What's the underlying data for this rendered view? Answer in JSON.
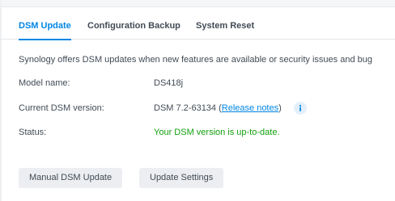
{
  "tabs": [
    {
      "label": "DSM Update",
      "active": true
    },
    {
      "label": "Configuration Backup",
      "active": false
    },
    {
      "label": "System Reset",
      "active": false
    }
  ],
  "description": "Synology offers DSM updates when new features are available or security issues and bug",
  "fields": {
    "model": {
      "label": "Model name:",
      "value": "DS418j"
    },
    "version": {
      "label": "Current DSM version:",
      "value": "DSM 7.2-63134",
      "open_paren": " (",
      "link_text": "Release notes",
      "close_paren": ")"
    },
    "status": {
      "label": "Status:",
      "value": "Your DSM version is up-to-date."
    }
  },
  "buttons": {
    "manual_update": "Manual DSM Update",
    "update_settings": "Update Settings"
  },
  "icons": {
    "info": "info-icon"
  },
  "colors": {
    "accent": "#0086e5",
    "status_ok": "#13a00e",
    "text": "#414b55",
    "button_bg": "#eceef1"
  }
}
